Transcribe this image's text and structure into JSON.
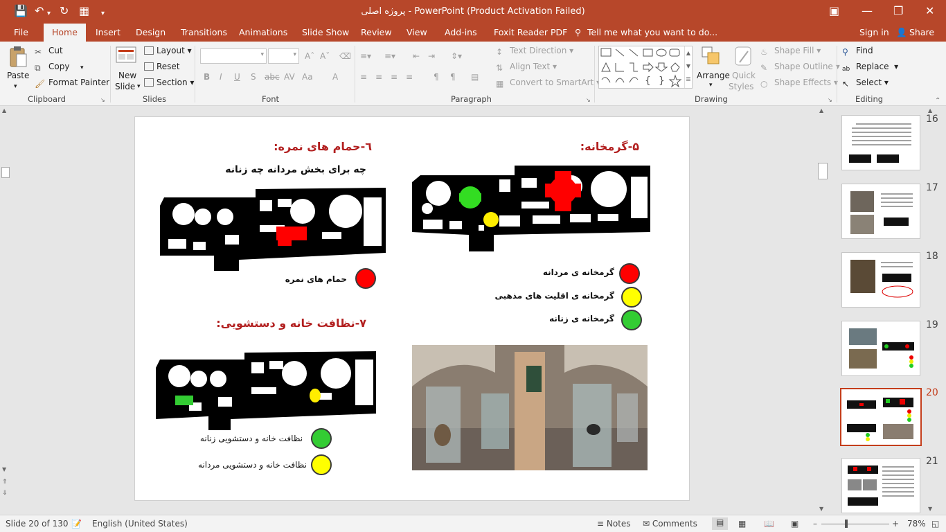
{
  "window": {
    "title": "پروژه اصلی - PowerPoint (Product Activation Failed)"
  },
  "tabs": [
    "File",
    "Home",
    "Insert",
    "Design",
    "Transitions",
    "Animations",
    "Slide Show",
    "Review",
    "View",
    "Add-ins",
    "Foxit Reader PDF"
  ],
  "tell_me": "Tell me what you want to do...",
  "account": {
    "sign_in": "Sign in",
    "share": "Share"
  },
  "ribbon": {
    "clipboard": {
      "label": "Clipboard",
      "paste": "Paste",
      "cut": "Cut",
      "copy": "Copy",
      "format_painter": "Format Painter"
    },
    "slides": {
      "label": "Slides",
      "new_slide_1": "New",
      "new_slide_2": "Slide",
      "layout": "Layout",
      "reset": "Reset",
      "section": "Section"
    },
    "font": {
      "label": "Font",
      "bold": "B",
      "italic": "I",
      "underline": "U",
      "strike": "S",
      "spacing": "AV",
      "case": "Aa",
      "color": "A"
    },
    "paragraph": {
      "label": "Paragraph",
      "text_direction": "Text Direction",
      "align_text": "Align Text",
      "smartart": "Convert to SmartArt"
    },
    "drawing": {
      "label": "Drawing",
      "arrange": "Arrange",
      "quick_styles_1": "Quick",
      "quick_styles_2": "Styles",
      "shape_fill": "Shape Fill",
      "shape_outline": "Shape Outline",
      "shape_effects": "Shape Effects"
    },
    "editing": {
      "label": "Editing",
      "find": "Find",
      "replace": "Replace",
      "select": "Select"
    }
  },
  "slide": {
    "heading_5": "۵-گرمخانه:",
    "heading_6": "٦-حمام های نمره:",
    "sub_6": "چه برای بخش مردانه چه زنانه",
    "heading_7": "۷-نظافت خانه و دستشویی:",
    "legend_5": [
      {
        "label": "گرمخانه ی مردانه",
        "color": "#ff0000"
      },
      {
        "label": "گرمخانه ی اقلیت های مذهبی",
        "color": "#ffff00"
      },
      {
        "label": "گرمخانه ی زنانه",
        "color": "#33cc33"
      }
    ],
    "legend_6": [
      {
        "label": "حمام های نمره",
        "color": "#ff0000"
      }
    ],
    "legend_7": [
      {
        "label": "نظافت خانه و دستشویی زنانه",
        "color": "#33cc33"
      },
      {
        "label": "نظافت خانه و دستشویی مردانه",
        "color": "#ffff00"
      }
    ]
  },
  "thumbnails": [
    {
      "number": "16"
    },
    {
      "number": "17"
    },
    {
      "number": "18"
    },
    {
      "number": "19"
    },
    {
      "number": "20",
      "selected": true
    },
    {
      "number": "21"
    }
  ],
  "status": {
    "slide_info": "Slide 20 of 130",
    "language": "English (United States)",
    "notes": "Notes",
    "comments": "Comments",
    "zoom": "78%"
  },
  "colors": {
    "accent": "#b7472a",
    "heading_red": "#b21f1f"
  }
}
